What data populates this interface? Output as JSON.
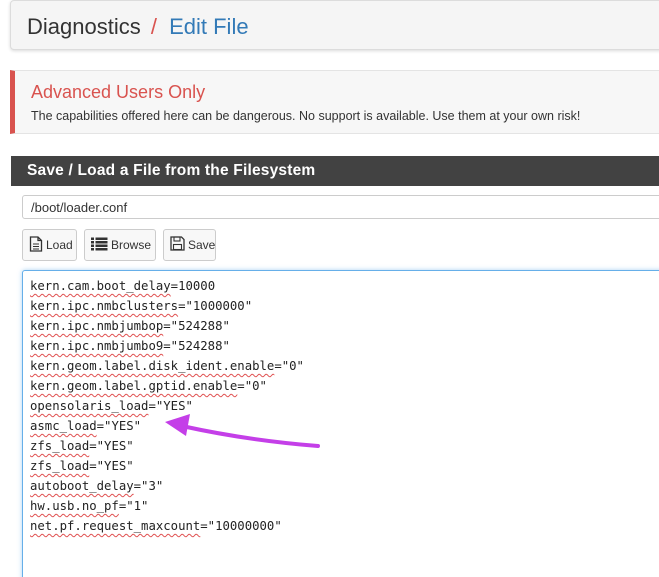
{
  "breadcrumb": {
    "root": "Diagnostics",
    "separator": "/",
    "current": "Edit File"
  },
  "alert": {
    "title": "Advanced Users Only",
    "text": "The capabilities offered here can be dangerous. No support is available. Use them at your own risk!"
  },
  "panel": {
    "title": "Save / Load a File from the Filesystem"
  },
  "file_path": {
    "value": "/boot/loader.conf"
  },
  "buttons": {
    "load": "Load",
    "browse": "Browse",
    "save": "Save"
  },
  "editor": {
    "lines": [
      {
        "key": "kern.cam.boot_delay",
        "rest": "=10000"
      },
      {
        "key": "kern.ipc.nmbclusters",
        "rest": "=\"1000000\""
      },
      {
        "key": "kern.ipc.nmbjumbop",
        "rest": "=\"524288\""
      },
      {
        "key": "kern.ipc.nmbjumbo9",
        "rest": "=\"524288\""
      },
      {
        "key": "kern.geom.label.disk_ident.enable",
        "rest": "=\"0\""
      },
      {
        "key": "kern.geom.label.gptid.enable",
        "rest": "=\"0\""
      },
      {
        "key": "opensolaris_load",
        "rest": "=\"YES\""
      },
      {
        "key": "asmc_load",
        "rest": "=\"YES\""
      },
      {
        "key": "zfs_load",
        "rest": "=\"YES\""
      },
      {
        "key": "zfs_load",
        "rest": "=\"YES\""
      },
      {
        "key": "autoboot_delay",
        "rest": "=\"3\""
      },
      {
        "key": "hw.usb.no_pf",
        "rest": "=\"1\""
      },
      {
        "key": "net.pf.request_maxcount",
        "rest": "=\"10000000\""
      }
    ]
  },
  "colors": {
    "accent_red": "#d9534f",
    "link_blue": "#337ab7",
    "panel_header": "#424242",
    "annotation_arrow": "#c43fe8"
  }
}
